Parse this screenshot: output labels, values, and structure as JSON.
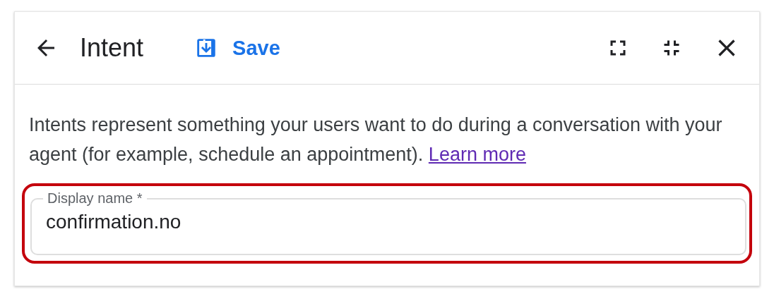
{
  "header": {
    "title": "Intent",
    "save_label": "Save"
  },
  "description": {
    "text": "Intents represent something your users want to do during a conversation with your agent (for example, schedule an appointment).",
    "link": "Learn more"
  },
  "display_name_field": {
    "label": "Display name *",
    "value": "confirmation.no",
    "highlighted": true
  }
}
